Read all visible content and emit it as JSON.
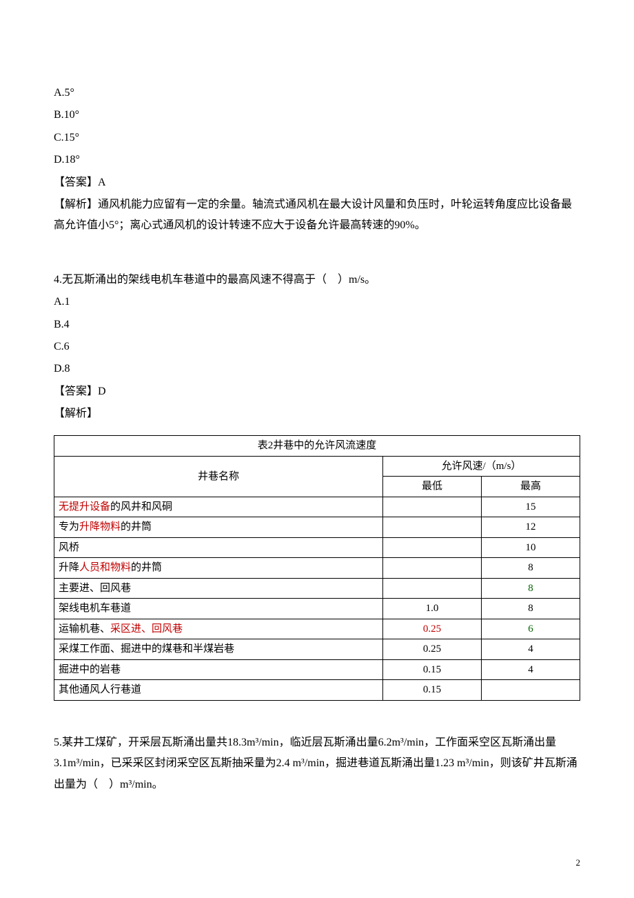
{
  "q3": {
    "optA": "A.5°",
    "optB": "B.10°",
    "optC": "C.15°",
    "optD": "D.18°",
    "answer": "【答案】A",
    "explain": "【解析】通风机能力应留有一定的余量。轴流式通风机在最大设计风量和负压时，叶轮运转角度应比设备最高允许值小5°；离心式通风机的设计转速不应大于设备允许最高转速的90%。"
  },
  "q4": {
    "stem": "4.无瓦斯涌出的架线电机车巷道中的最高风速不得高于（　）m/s。",
    "optA": "A.1",
    "optB": "B.4",
    "optC": "C.6",
    "optD": "D.8",
    "answer": "【答案】D",
    "explain_label": "【解析】"
  },
  "table": {
    "title": "表2井巷中的允许风流速度",
    "col_name": "井巷名称",
    "col_speed": "允许风速/（m/s）",
    "col_min": "最低",
    "col_max": "最高",
    "rows": [
      {
        "name_pre": "",
        "name_red": "无提升设备",
        "name_post": "的风井和风硐",
        "min": "",
        "max": "15",
        "max_color": ""
      },
      {
        "name_pre": "专为",
        "name_red": "升降物料",
        "name_post": "的井筒",
        "min": "",
        "max": "12",
        "max_color": ""
      },
      {
        "name_pre": "风桥",
        "name_red": "",
        "name_post": "",
        "min": "",
        "max": "10",
        "max_color": ""
      },
      {
        "name_pre": "升降",
        "name_red": "人员和物料",
        "name_post": "的井筒",
        "min": "",
        "max": "8",
        "max_color": ""
      },
      {
        "name_pre": "主要进、回风巷",
        "name_red": "",
        "name_post": "",
        "min": "",
        "max": "8",
        "max_color": "green"
      },
      {
        "name_pre": "架线电机车巷道",
        "name_red": "",
        "name_post": "",
        "min": "1.0",
        "max": "8",
        "max_color": ""
      },
      {
        "name_pre": "运输机巷、",
        "name_red": "采区进、回风巷",
        "name_post": "",
        "min": "0.25",
        "min_color": "red",
        "max": "6",
        "max_color": "green"
      },
      {
        "name_pre": "采煤工作面、掘进中的煤巷和半煤岩巷",
        "name_red": "",
        "name_post": "",
        "min": "0.25",
        "max": "4",
        "max_color": ""
      },
      {
        "name_pre": "掘进中的岩巷",
        "name_red": "",
        "name_post": "",
        "min": "0.15",
        "max": "4",
        "max_color": ""
      },
      {
        "name_pre": "其他通风人行巷道",
        "name_red": "",
        "name_post": "",
        "min": "0.15",
        "max": "",
        "max_color": ""
      }
    ]
  },
  "q5": {
    "stem": "5.某井工煤矿，开采层瓦斯涌出量共18.3m³/min，临近层瓦斯涌出量6.2m³/min，工作面采空区瓦斯涌出量3.1m³/min，已采采区封闭采空区瓦斯抽采量为2.4 m³/min，掘进巷道瓦斯涌出量1.23 m³/min，则该矿井瓦斯涌出量为（　）m³/min。"
  },
  "page_number": "2"
}
